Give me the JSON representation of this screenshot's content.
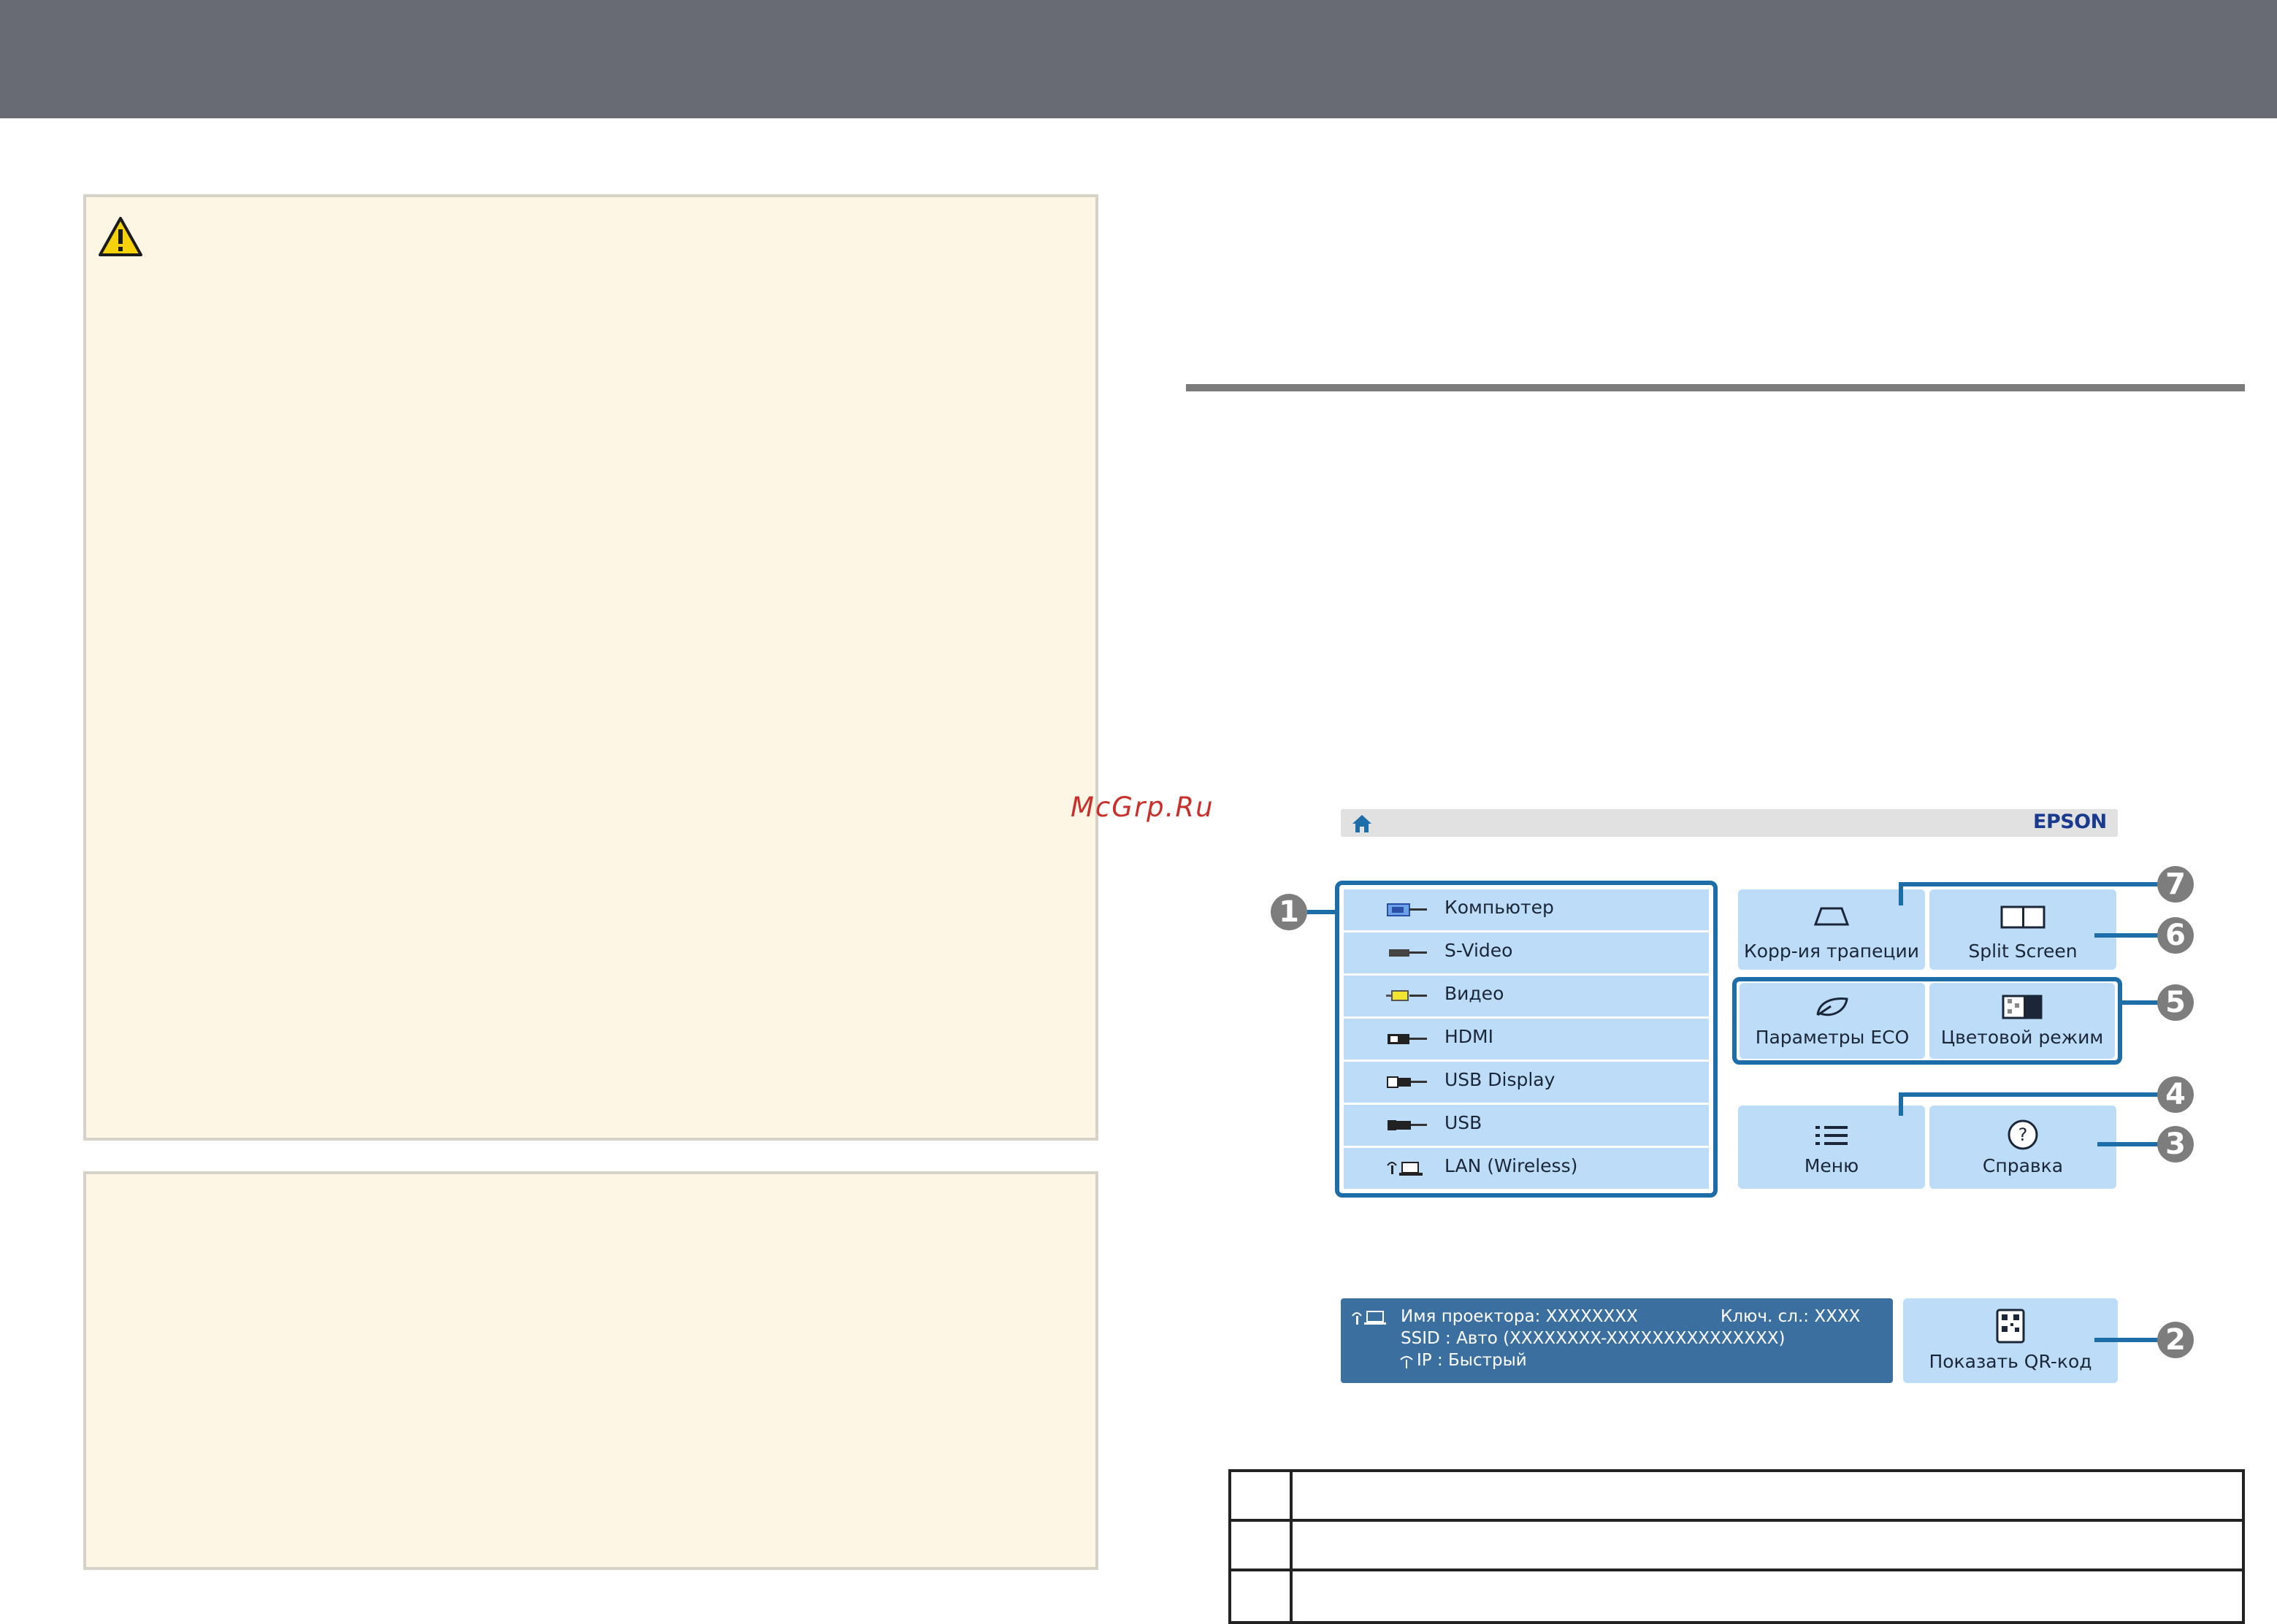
{
  "watermark": "McGrp.Ru",
  "home_screen": {
    "brand": "EPSON",
    "sources": [
      {
        "icon": "computer-port-icon",
        "label": "Компьютер"
      },
      {
        "icon": "s-video-port-icon",
        "label": "S-Video"
      },
      {
        "icon": "video-port-icon",
        "label": "Видео"
      },
      {
        "icon": "hdmi-port-icon",
        "label": "HDMI"
      },
      {
        "icon": "usb-display-port-icon",
        "label": "USB Display"
      },
      {
        "icon": "usb-port-icon",
        "label": "USB"
      },
      {
        "icon": "lan-wireless-icon",
        "label": "LAN (Wireless)"
      }
    ],
    "tiles": {
      "keystone": "Корр-ия трапеции",
      "split_screen": "Split Screen",
      "eco": "Параметры ECO",
      "color_mode": "Цветовой режим",
      "menu": "Меню",
      "help": "Справка",
      "qr": "Показать QR-код"
    },
    "info": {
      "projector_name": "Имя проектора:  XXXXXXXX",
      "key": "Ключ. сл.:  XXXX",
      "ssid": "SSID  :  Авто (XXXXXXXX-XXXXXXXXXXXXXXX)",
      "ip": "IP  :  Быстрый"
    },
    "callouts": [
      "1",
      "2",
      "3",
      "4",
      "5",
      "6",
      "7"
    ]
  },
  "colors": {
    "accent": "#1d6ea8",
    "tile": "#bcdcf7",
    "note_bg": "#fdf6e4",
    "header": "#686b74"
  }
}
